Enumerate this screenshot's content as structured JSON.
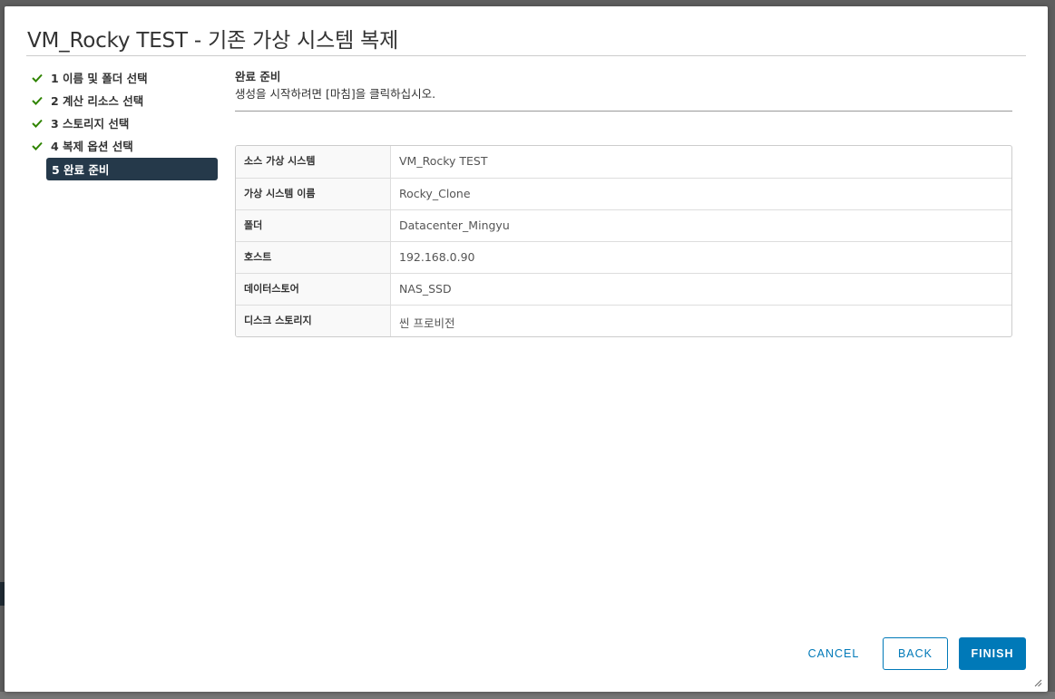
{
  "dialog": {
    "title": "VM_Rocky TEST - 기존 가상 시스템 복제"
  },
  "steps": [
    {
      "number": "1",
      "label": "1 이름 및 폴더 선택",
      "status": "completed"
    },
    {
      "number": "2",
      "label": "2 계산 리소스 선택",
      "status": "completed"
    },
    {
      "number": "3",
      "label": "3 스토리지 선택",
      "status": "completed"
    },
    {
      "number": "4",
      "label": "4 복제 옵션 선택",
      "status": "completed"
    },
    {
      "number": "5",
      "label": "5 완료 준비",
      "status": "active"
    }
  ],
  "content": {
    "title": "완료 준비",
    "description": "생성을 시작하려면 [마침]을 클릭하십시오."
  },
  "summary": [
    {
      "key": "소스 가상 시스템",
      "value": "VM_Rocky TEST"
    },
    {
      "key": "가상 시스템 이름",
      "value": "Rocky_Clone"
    },
    {
      "key": "폴더",
      "value": "Datacenter_Mingyu"
    },
    {
      "key": "호스트",
      "value": "192.168.0.90"
    },
    {
      "key": "데이터스토어",
      "value": "NAS_SSD"
    },
    {
      "key": "디스크 스토리지",
      "value": "씬 프로비전"
    }
  ],
  "footer": {
    "cancel_label": "CANCEL",
    "back_label": "BACK",
    "finish_label": "FINISH"
  },
  "colors": {
    "accent": "#0079b8",
    "active_step_bg": "#25394a",
    "check_green": "#2f8400"
  }
}
